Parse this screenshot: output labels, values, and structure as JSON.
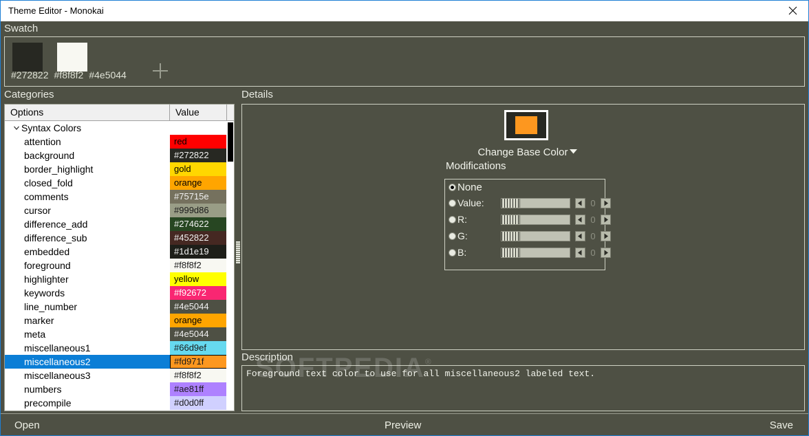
{
  "window": {
    "title": "Theme Editor - Monokai",
    "close_icon": "close-icon"
  },
  "swatch": {
    "header": "Swatch",
    "add_icon": "plus-icon",
    "colors": [
      {
        "hex": "#272822"
      },
      {
        "hex": "#f8f8f2"
      },
      {
        "hex": "#4e5044"
      }
    ],
    "hex_labels": [
      "#272822",
      "#f8f8f2",
      "#4e5044"
    ]
  },
  "categories": {
    "header": "Categories",
    "columns": [
      "Options",
      "Value"
    ],
    "group": {
      "label": "Syntax Colors",
      "expander_icon": "chevron-down-icon",
      "expanded": true
    },
    "rows": [
      {
        "name": "attention",
        "value": "red",
        "bg": "#ff0000",
        "fg": "#000000"
      },
      {
        "name": "background",
        "value": "#272822",
        "bg": "#272822",
        "fg": "#f0f0f0"
      },
      {
        "name": "border_highlight",
        "value": "gold",
        "bg": "#ffd700",
        "fg": "#000000"
      },
      {
        "name": "closed_fold",
        "value": "orange",
        "bg": "#ffa500",
        "fg": "#000000"
      },
      {
        "name": "comments",
        "value": "#75715e",
        "bg": "#75715e",
        "fg": "#f0f0f0"
      },
      {
        "name": "cursor",
        "value": "#999d86",
        "bg": "#999d86",
        "fg": "#1a1a1a"
      },
      {
        "name": "difference_add",
        "value": "#274622",
        "bg": "#274622",
        "fg": "#f0f0f0"
      },
      {
        "name": "difference_sub",
        "value": "#452822",
        "bg": "#452822",
        "fg": "#f0f0f0"
      },
      {
        "name": "embedded",
        "value": "#1d1e19",
        "bg": "#1d1e19",
        "fg": "#f0f0f0"
      },
      {
        "name": "foreground",
        "value": "#f8f8f2",
        "bg": "#f8f8f2",
        "fg": "#1a1a1a"
      },
      {
        "name": "highlighter",
        "value": "yellow",
        "bg": "#ffff00",
        "fg": "#000000"
      },
      {
        "name": "keywords",
        "value": "#f92672",
        "bg": "#f92672",
        "fg": "#ffffff"
      },
      {
        "name": "line_number",
        "value": "#4e5044",
        "bg": "#4e5044",
        "fg": "#f0f0f0"
      },
      {
        "name": "marker",
        "value": "orange",
        "bg": "#ffa500",
        "fg": "#000000"
      },
      {
        "name": "meta",
        "value": "#4e5044",
        "bg": "#4e5044",
        "fg": "#f0f0f0"
      },
      {
        "name": "miscellaneous1",
        "value": "#66d9ef",
        "bg": "#66d9ef",
        "fg": "#1a1a1a"
      },
      {
        "name": "miscellaneous2",
        "value": "#fd971f",
        "bg": "#fd971f",
        "fg": "#1a1a1a",
        "selected": true
      },
      {
        "name": "miscellaneous3",
        "value": "#f8f8f2",
        "bg": "#f8f8f2",
        "fg": "#1a1a1a"
      },
      {
        "name": "numbers",
        "value": "#ae81ff",
        "bg": "#ae81ff",
        "fg": "#1a1a1a"
      },
      {
        "name": "precompile",
        "value": "#d0d0ff",
        "bg": "#d0d0ff",
        "fg": "#1a1a1a"
      }
    ]
  },
  "details": {
    "header": "Details",
    "base_color": "#fd971f",
    "base_color_backdrop": "#272822",
    "change_base_label": "Change Base Color",
    "change_base_icon": "caret-down-icon",
    "modifications_label": "Modifications",
    "modifications": [
      {
        "label": "None",
        "selected": true,
        "has_slider": false
      },
      {
        "label": "Value:",
        "selected": false,
        "has_slider": true,
        "value": "0",
        "slider_pos": 0
      },
      {
        "label": "R:",
        "selected": false,
        "has_slider": true,
        "value": "0",
        "slider_pos": 0
      },
      {
        "label": "G:",
        "selected": false,
        "has_slider": true,
        "value": "0",
        "slider_pos": 0
      },
      {
        "label": "B:",
        "selected": false,
        "has_slider": true,
        "value": "0",
        "slider_pos": 0
      }
    ],
    "spin_left_icon": "arrow-left-icon",
    "spin_right_icon": "arrow-right-icon"
  },
  "description": {
    "header": "Description",
    "text": "Foreground text color to use for all miscellaneous2 labeled text."
  },
  "watermark": {
    "text": "SOFTPEDIA",
    "mark": "®"
  },
  "bottom_bar": {
    "open": "Open",
    "preview": "Preview",
    "save": "Save"
  }
}
